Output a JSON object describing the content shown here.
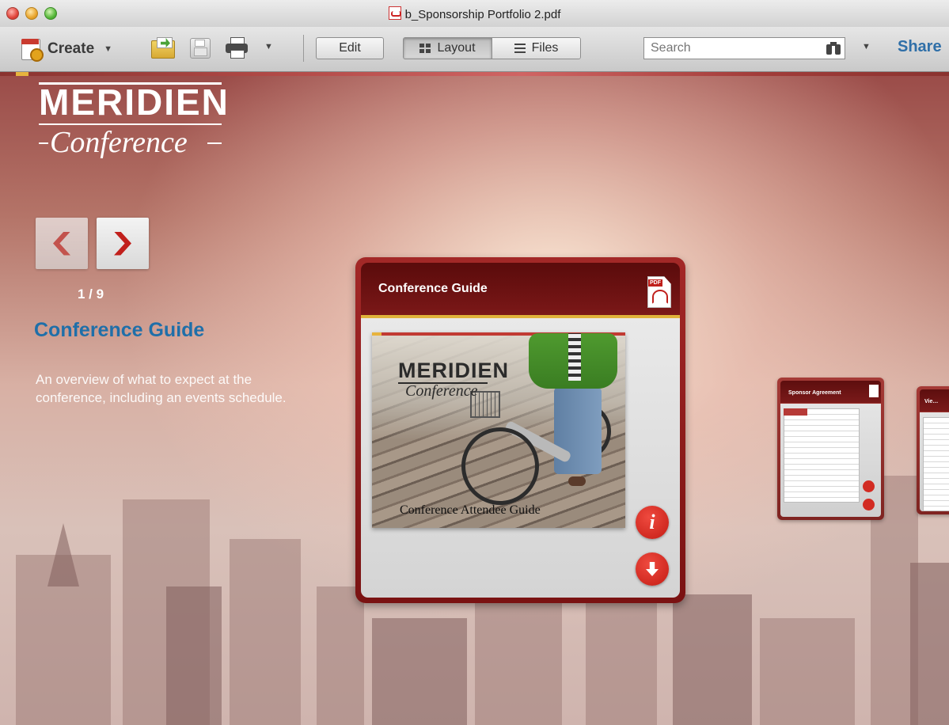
{
  "window": {
    "title": "b_Sponsorship Portfolio 2.pdf"
  },
  "toolbar": {
    "create_label": "Create",
    "edit_label": "Edit",
    "layout_label": "Layout",
    "files_label": "Files",
    "search_placeholder": "Search",
    "share_label": "Share",
    "active_view": "Layout"
  },
  "portfolio": {
    "logo_main": "MERIDIEN",
    "logo_sub": "Conference",
    "counter": "1 / 9",
    "current_item": {
      "title": "Conference Guide",
      "description": "An overview of what to expect at the conference, including an events schedule."
    },
    "card": {
      "header_title": "Conference Guide",
      "thumb_logo_main": "MERIDIEN",
      "thumb_logo_sub": "Conference",
      "thumb_caption": "Conference Attendee Guide",
      "info_symbol": "i"
    },
    "side_cards": [
      {
        "title": "Sponsor Agreement"
      },
      {
        "title": "Vie…"
      }
    ]
  },
  "colors": {
    "accent_blue": "#1f6fa9",
    "card_red": "#7a1212",
    "button_red": "#c41c14",
    "gold": "#e0b23a"
  },
  "icons": [
    "create-icon",
    "open-icon",
    "save-icon",
    "print-icon",
    "binoculars-icon",
    "pdf-icon",
    "info-icon",
    "download-icon",
    "chevron-left-icon",
    "chevron-right-icon"
  ]
}
